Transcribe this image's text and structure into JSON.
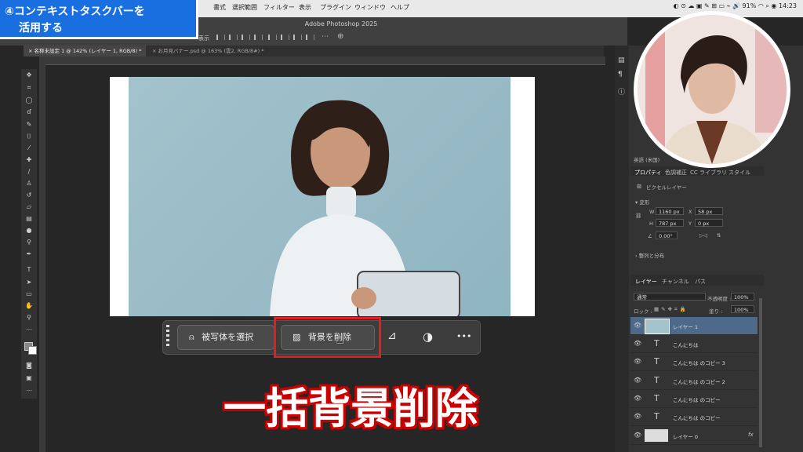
{
  "menubar": {
    "items": [
      "書式",
      "選択範囲",
      "フィルター",
      "表示",
      "プラグイン",
      "ウィンドウ",
      "ヘルプ"
    ],
    "battery": "91%",
    "clock": "14:23"
  },
  "app": {
    "title": "Adobe Photoshop 2025"
  },
  "options_bar": {
    "label": "表示"
  },
  "tabs": [
    {
      "label": "名称未設定 1 @ 142% (レイヤー 1, RGB/8) *"
    },
    {
      "label": "お月見バナー.psd @ 163% (雲2, RGB/8#) *"
    }
  ],
  "taskbar": {
    "select_subject": "被写体を選択",
    "remove_background": "背景を削除",
    "more": "•••"
  },
  "overlay": {
    "step_line1": "④コンテキストタスクバーを",
    "step_line2": "活用する",
    "caption": "一括背景削除"
  },
  "properties": {
    "tabs": [
      "プロパティ",
      "色調補正",
      "CC ライブラリ",
      "スタイル"
    ],
    "layer_kind": "ピクセルレイヤー",
    "transform_header": "変形",
    "w": "1160 px",
    "h": "787 px",
    "x": "58 px",
    "y": "0 px",
    "angle": "0.00°",
    "align_header": "整列と分布",
    "font_lang": "英語 (米国)"
  },
  "layers_panel": {
    "tabs": [
      "レイヤー",
      "チャンネル",
      "パス"
    ],
    "blend_mode": "通常",
    "opacity_label": "不透明度 :",
    "opacity": "100%",
    "lock_label": "ロック :",
    "fill_label": "塗り :",
    "fill": "100%",
    "layers": [
      {
        "name": "レイヤー 1",
        "kind": "pixel",
        "selected": true
      },
      {
        "name": "こんにちは",
        "kind": "text"
      },
      {
        "name": "こんにちは のコピー 3",
        "kind": "text"
      },
      {
        "name": "こんにちは のコピー 2",
        "kind": "text"
      },
      {
        "name": "こんにちは のコピー",
        "kind": "text"
      },
      {
        "name": "レイヤー 0",
        "kind": "pixel"
      }
    ],
    "fx": "fx"
  },
  "colors": {
    "accent_blue": "#1a6fe0",
    "highlight_red": "#e02020",
    "caption_outline": "#cc0000"
  }
}
